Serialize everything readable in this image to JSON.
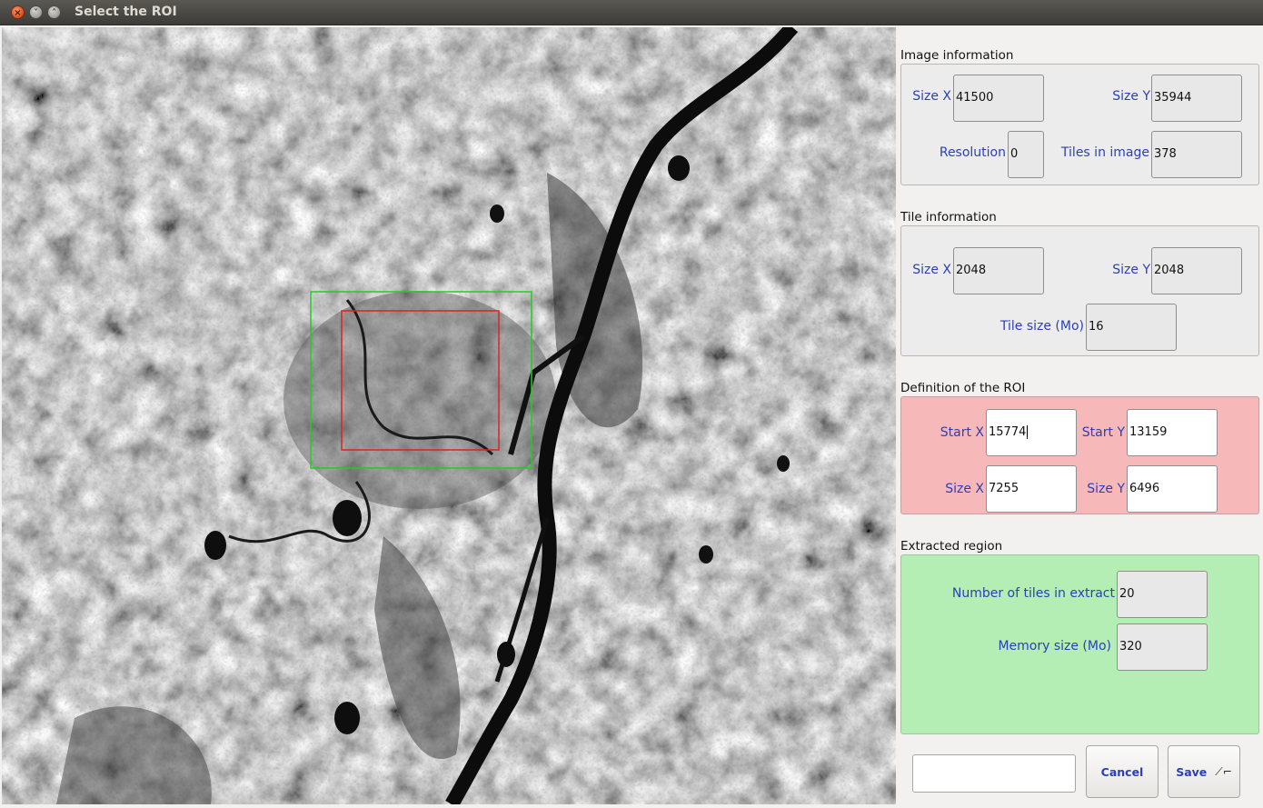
{
  "window": {
    "title": "Select the ROI"
  },
  "image_information": {
    "title": "Image information",
    "size_x_label": "Size X",
    "size_x_value": "41500",
    "size_y_label": "Size Y",
    "size_y_value": "35944",
    "resolution_label": "Resolution",
    "resolution_value": "0",
    "tiles_label": "Tiles in image",
    "tiles_value": "378"
  },
  "tile_information": {
    "title": "Tile information",
    "size_x_label": "Size X",
    "size_x_value": "2048",
    "size_y_label": "Size Y",
    "size_y_value": "2048",
    "tile_size_label": "Tile size (Mo)",
    "tile_size_value": "16"
  },
  "roi": {
    "title": "Definition of the ROI",
    "start_x_label": "Start X",
    "start_x_value": "15774",
    "start_y_label": "Start Y",
    "start_y_value": "13159",
    "size_x_label": "Size X",
    "size_x_value": "7255",
    "size_y_label": "Size Y",
    "size_y_value": "6496",
    "color": "#f6b8b8"
  },
  "extracted_region": {
    "title": "Extracted region",
    "tiles_label": "Number of tiles in extract",
    "tiles_value": "20",
    "memory_label": "Memory size (Mo)",
    "memory_value": "320",
    "color": "#b4eeb4"
  },
  "buttons": {
    "cancel_label": "Cancel",
    "save_label": "Save",
    "status_value": ""
  },
  "overlay": {
    "tile_box_color": "#22cc22",
    "roi_box_color": "#dd2222"
  },
  "icons": {
    "close": "close-icon",
    "minimize": "minimize-icon",
    "maximize": "maximize-icon"
  }
}
